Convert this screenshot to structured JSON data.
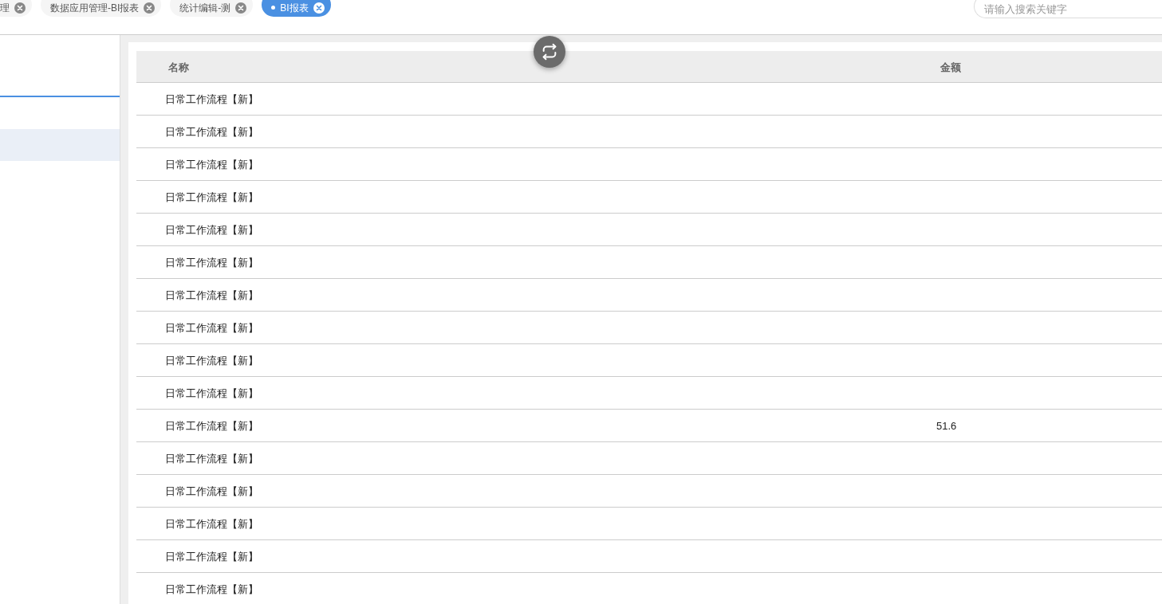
{
  "tabs": [
    {
      "label": "理",
      "selected": false
    },
    {
      "label": "数据应用管理-BI报表",
      "selected": false
    },
    {
      "label": "统计编辑-测",
      "selected": false
    },
    {
      "label": "BI报表",
      "selected": true
    }
  ],
  "search": {
    "placeholder": "请输入搜索关键字"
  },
  "sidebar": {
    "items": [
      {
        "selected": true
      }
    ]
  },
  "table": {
    "columns": [
      "名称",
      "金额"
    ],
    "rows": [
      {
        "name": "日常工作流程【新】"
      },
      {
        "name": "日常工作流程【新】"
      },
      {
        "name": "日常工作流程【新】"
      },
      {
        "name": "日常工作流程【新】"
      },
      {
        "name": "日常工作流程【新】"
      },
      {
        "name": "日常工作流程【新】"
      },
      {
        "name": "日常工作流程【新】"
      },
      {
        "name": "日常工作流程【新】"
      },
      {
        "name": "日常工作流程【新】"
      },
      {
        "name": "日常工作流程【新】"
      },
      {
        "name": "日常工作流程【新】",
        "amount": "51.6"
      },
      {
        "name": "日常工作流程【新】"
      },
      {
        "name": "日常工作流程【新】"
      },
      {
        "name": "日常工作流程【新】"
      },
      {
        "name": "日常工作流程【新】"
      },
      {
        "name": "日常工作流程【新】"
      }
    ]
  }
}
